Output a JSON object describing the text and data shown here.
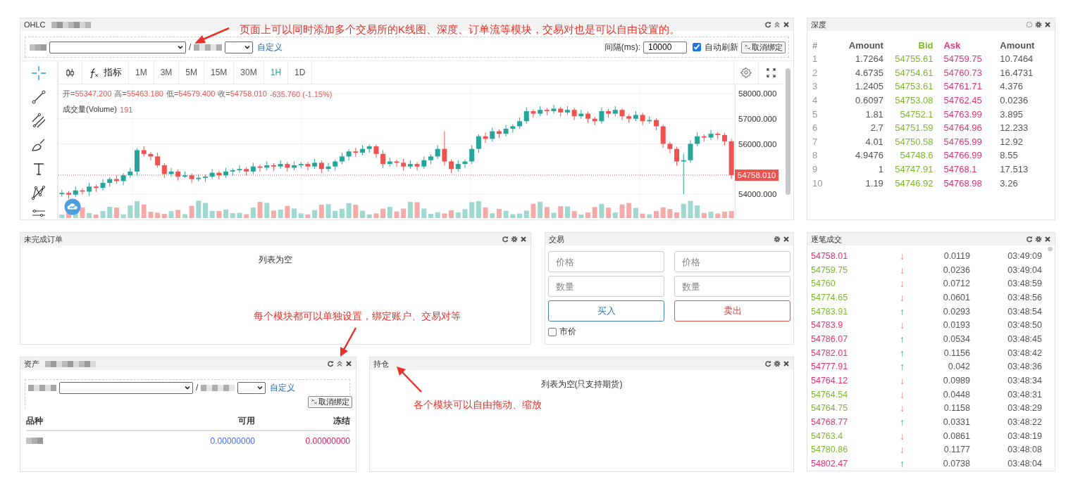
{
  "ohlc": {
    "title": "OHLC",
    "tools": [
      {
        "kind": "refresh"
      },
      {
        "kind": "collapse"
      },
      {
        "kind": "close"
      }
    ],
    "pair": {
      "separator": "/",
      "custom_link": "自定义",
      "interval_label": "间隔(ms):",
      "interval_value": "10000",
      "auto_refresh": {
        "label": "自动刷新",
        "checked": true
      },
      "unbind_button": "取消绑定"
    },
    "toolbar": {
      "indicator_button": "指标",
      "timeframes": [
        {
          "label": "1M",
          "selected": false
        },
        {
          "label": "3M",
          "selected": false
        },
        {
          "label": "5M",
          "selected": false
        },
        {
          "label": "15M",
          "selected": false
        },
        {
          "label": "30M",
          "selected": false
        },
        {
          "label": "1H",
          "selected": true
        },
        {
          "label": "1D",
          "selected": false
        }
      ]
    },
    "legend": {
      "items": [
        {
          "label": "开=",
          "value": "55347.200"
        },
        {
          "label": "高=",
          "value": "55463.180"
        },
        {
          "label": "低=",
          "value": "54579.400"
        },
        {
          "label": "收=",
          "value": "54758.010"
        }
      ],
      "change": "-635.760 (-1.15%)",
      "volume_label": "成交量(Volume)",
      "volume_value": "191"
    },
    "chart_data": {
      "type": "candlestick",
      "grid": true,
      "ylim": [
        53049,
        58364
      ],
      "categories": [
        null,
        null,
        null,
        null,
        null,
        null,
        null,
        null,
        null,
        null,
        null,
        null,
        null,
        null,
        null,
        null,
        null,
        null,
        null,
        null,
        null,
        null,
        null,
        null,
        null,
        null,
        null,
        null,
        null,
        null,
        null,
        null,
        null,
        null,
        null,
        null,
        null,
        null,
        null,
        null,
        null,
        null,
        null,
        null,
        null,
        null,
        null,
        null,
        null,
        null,
        null,
        null,
        null,
        null,
        null,
        null,
        null,
        null,
        null,
        null,
        null,
        null,
        null,
        null,
        null,
        null,
        null,
        null,
        null,
        null,
        null,
        null,
        null,
        null,
        null,
        null,
        null,
        null,
        null,
        null,
        null,
        null,
        null,
        null,
        null,
        null,
        null,
        null,
        null,
        null,
        null,
        null,
        null,
        null,
        null,
        null,
        null,
        null,
        null
      ],
      "yticks": [
        {
          "value": 58000,
          "label": "58000.000"
        },
        {
          "value": 57000,
          "label": "57000.000"
        },
        {
          "value": 56000,
          "label": "56000.000"
        },
        {
          "value": 54000,
          "label": "54000.000"
        }
      ],
      "ohlc": [
        [
          54000,
          54170,
          53900,
          54050
        ],
        [
          54050,
          54130,
          53820,
          53980
        ],
        [
          53980,
          54300,
          53880,
          54150
        ],
        [
          54150,
          54230,
          53990,
          54100
        ],
        [
          54100,
          54450,
          53940,
          54300
        ],
        [
          54300,
          54380,
          54090,
          54250
        ],
        [
          54250,
          54600,
          54150,
          54450
        ],
        [
          54450,
          54680,
          54290,
          54600
        ],
        [
          54600,
          54750,
          54420,
          54520
        ],
        [
          54520,
          54830,
          54360,
          54750
        ],
        [
          54750,
          55050,
          54650,
          54900
        ],
        [
          54900,
          55830,
          54740,
          55750
        ],
        [
          55750,
          55900,
          55500,
          55600
        ],
        [
          55600,
          55680,
          55340,
          55500
        ],
        [
          55500,
          55650,
          55050,
          55150
        ],
        [
          55150,
          55230,
          54640,
          54800
        ],
        [
          54800,
          55050,
          54700,
          54900
        ],
        [
          54900,
          54980,
          54540,
          54700
        ],
        [
          54700,
          54900,
          54650,
          54750
        ],
        [
          54750,
          54830,
          54440,
          54600
        ],
        [
          54600,
          54800,
          54500,
          54650
        ],
        [
          54650,
          54780,
          54490,
          54700
        ],
        [
          54700,
          55000,
          54600,
          54850
        ],
        [
          54850,
          54930,
          54590,
          54750
        ],
        [
          54750,
          55050,
          54650,
          54900
        ],
        [
          54900,
          55030,
          54740,
          54950
        ],
        [
          54950,
          55150,
          54850,
          55000
        ],
        [
          55000,
          55080,
          54740,
          54900
        ],
        [
          54900,
          55250,
          54800,
          55100
        ],
        [
          55100,
          55180,
          54890,
          55050
        ],
        [
          55050,
          55300,
          54950,
          55150
        ],
        [
          55150,
          55230,
          54940,
          55100
        ],
        [
          55100,
          55350,
          55000,
          55200
        ],
        [
          55200,
          55280,
          54890,
          55050
        ],
        [
          55050,
          55300,
          54950,
          55150
        ],
        [
          55150,
          55280,
          55040,
          55200
        ],
        [
          55200,
          55280,
          54940,
          55100
        ],
        [
          55100,
          55400,
          55000,
          55250
        ],
        [
          55250,
          55330,
          54840,
          55000
        ],
        [
          55000,
          55250,
          54900,
          55100
        ],
        [
          55100,
          55380,
          54940,
          55300
        ],
        [
          55300,
          55650,
          55200,
          55500
        ],
        [
          55500,
          55780,
          55340,
          55700
        ],
        [
          55700,
          55850,
          55490,
          55650
        ],
        [
          55650,
          55950,
          55550,
          55800
        ],
        [
          55800,
          55980,
          55640,
          55900
        ],
        [
          55900,
          55980,
          55440,
          55600
        ],
        [
          55600,
          55750,
          55040,
          55200
        ],
        [
          55200,
          55450,
          55100,
          55300
        ],
        [
          55300,
          55380,
          55090,
          55250
        ],
        [
          55250,
          55400,
          54940,
          55100
        ],
        [
          55100,
          55350,
          55000,
          55200
        ],
        [
          55200,
          55280,
          54940,
          55100
        ],
        [
          55100,
          55500,
          55000,
          55350
        ],
        [
          55350,
          55580,
          55190,
          55500
        ],
        [
          55500,
          55950,
          55400,
          55800
        ],
        [
          55800,
          56500,
          55140,
          55300
        ],
        [
          55300,
          55380,
          54840,
          55000
        ],
        [
          55000,
          55350,
          54900,
          55200
        ],
        [
          55200,
          55380,
          55040,
          55300
        ],
        [
          55300,
          55950,
          55200,
          55800
        ],
        [
          55800,
          56380,
          55640,
          56300
        ],
        [
          56300,
          56450,
          56040,
          56200
        ],
        [
          56200,
          56650,
          56100,
          56500
        ],
        [
          56500,
          56580,
          56240,
          56400
        ],
        [
          56400,
          56750,
          56300,
          56600
        ],
        [
          56600,
          56780,
          56440,
          56700
        ],
        [
          56700,
          57050,
          56600,
          56900
        ],
        [
          56900,
          57450,
          56800,
          57300
        ],
        [
          57300,
          57380,
          57040,
          57200
        ],
        [
          57200,
          57500,
          57100,
          57350
        ],
        [
          57350,
          57430,
          57140,
          57300
        ],
        [
          57300,
          57550,
          57200,
          57400
        ],
        [
          57400,
          57480,
          57090,
          57250
        ],
        [
          57250,
          57500,
          57150,
          57350
        ],
        [
          57350,
          57430,
          56940,
          57100
        ],
        [
          57100,
          57350,
          57000,
          57200
        ],
        [
          57200,
          57280,
          56840,
          57000
        ],
        [
          57000,
          57080,
          56740,
          56900
        ],
        [
          56900,
          57450,
          56800,
          57300
        ],
        [
          57300,
          57380,
          57040,
          57200
        ],
        [
          57200,
          57500,
          57100,
          57350
        ],
        [
          57350,
          57430,
          56940,
          57100
        ],
        [
          57100,
          57180,
          56840,
          57000
        ],
        [
          57000,
          57300,
          56900,
          57150
        ],
        [
          57150,
          57230,
          56740,
          56900
        ],
        [
          56900,
          57100,
          56800,
          56950
        ],
        [
          56950,
          57030,
          56540,
          56700
        ],
        [
          56700,
          56780,
          55840,
          56000
        ],
        [
          56000,
          56080,
          55640,
          55800
        ],
        [
          55800,
          55880,
          55140,
          55300
        ],
        [
          55300,
          55600,
          54000,
          55350
        ],
        [
          55350,
          56150,
          55250,
          56000
        ],
        [
          56000,
          56450,
          55900,
          56300
        ],
        [
          56300,
          56380,
          56090,
          56250
        ],
        [
          56250,
          56550,
          56150,
          56400
        ],
        [
          56400,
          56480,
          56190,
          56350
        ],
        [
          56350,
          56430,
          55940,
          56100
        ],
        [
          56100,
          56200,
          54600,
          54758
        ]
      ]
    },
    "last_price": "54758.010"
  },
  "depth": {
    "title": "深度",
    "tools": [
      {
        "kind": "spinner"
      },
      {
        "kind": "settings"
      },
      {
        "kind": "close"
      }
    ],
    "columns": [
      "#",
      "Amount",
      "Bid",
      "Ask",
      "Amount"
    ],
    "rows": [
      [
        "1",
        "1.7264",
        "54755.61",
        "54759.75",
        "10.7464"
      ],
      [
        "2",
        "4.6735",
        "54754.61",
        "54760.73",
        "16.4731"
      ],
      [
        "3",
        "1.2405",
        "54753.61",
        "54761.71",
        "4.376"
      ],
      [
        "4",
        "0.6097",
        "54753.08",
        "54762.45",
        "0.0236"
      ],
      [
        "5",
        "1.81",
        "54752.1",
        "54763.99",
        "3.895"
      ],
      [
        "6",
        "2.7",
        "54751.59",
        "54764.96",
        "12.233"
      ],
      [
        "7",
        "4.01",
        "54750.58",
        "54765.99",
        "12.92"
      ],
      [
        "8",
        "4.9476",
        "54748.6",
        "54766.99",
        "8.55"
      ],
      [
        "9",
        "1",
        "54747.91",
        "54768.1",
        "17.513"
      ],
      [
        "10",
        "1.19",
        "54746.92",
        "54768.98",
        "3.26"
      ]
    ]
  },
  "orders": {
    "title": "未完成订单",
    "tools": [
      {
        "kind": "refresh"
      },
      {
        "kind": "settings"
      },
      {
        "kind": "close"
      }
    ],
    "empty_text": "列表为空"
  },
  "trade": {
    "title": "交易",
    "tools": [
      {
        "kind": "settings"
      },
      {
        "kind": "close"
      }
    ],
    "sides": [
      {
        "kind": "buy",
        "price_placeholder": "价格",
        "amount_placeholder": "数量",
        "button": "买入"
      },
      {
        "kind": "sell",
        "price_placeholder": "价格",
        "amount_placeholder": "数量",
        "button": "卖出"
      }
    ],
    "market_order": {
      "label": "市价",
      "checked": false
    }
  },
  "trades": {
    "title": "逐笔成交",
    "tools": [
      {
        "kind": "refresh"
      },
      {
        "kind": "settings"
      },
      {
        "kind": "close"
      }
    ],
    "rows": [
      {
        "price": "54758.01",
        "color": "#e8336d",
        "kind": "down",
        "arrow": "↓",
        "amount": "0.0119",
        "time": "03:49:09"
      },
      {
        "price": "54759.75",
        "color": "#7cb82f",
        "kind": "down",
        "arrow": "↓",
        "amount": "0.0236",
        "time": "03:49:04"
      },
      {
        "price": "54760",
        "color": "#7cb82f",
        "kind": "down",
        "arrow": "↓",
        "amount": "0.0712",
        "time": "03:48:59"
      },
      {
        "price": "54774.65",
        "color": "#7cb82f",
        "kind": "down",
        "arrow": "↓",
        "amount": "0.0601",
        "time": "03:48:56"
      },
      {
        "price": "54783.91",
        "color": "#7cb82f",
        "kind": "up",
        "arrow": "↑",
        "amount": "0.0293",
        "time": "03:48:54"
      },
      {
        "price": "54783.9",
        "color": "#e8336d",
        "kind": "down",
        "arrow": "↓",
        "amount": "0.0193",
        "time": "03:48:50"
      },
      {
        "price": "54786.07",
        "color": "#e8336d",
        "kind": "up",
        "arrow": "↑",
        "amount": "0.0534",
        "time": "03:48:45"
      },
      {
        "price": "54782.01",
        "color": "#e8336d",
        "kind": "up",
        "arrow": "↑",
        "amount": "0.1156",
        "time": "03:48:42"
      },
      {
        "price": "54777.91",
        "color": "#e8336d",
        "kind": "up",
        "arrow": "↑",
        "amount": "0.042",
        "time": "03:48:36"
      },
      {
        "price": "54764.12",
        "color": "#e8336d",
        "kind": "down",
        "arrow": "↓",
        "amount": "0.0989",
        "time": "03:48:34"
      },
      {
        "price": "54764.54",
        "color": "#7cb82f",
        "kind": "down",
        "arrow": "↓",
        "amount": "0.0448",
        "time": "03:48:31"
      },
      {
        "price": "54764.75",
        "color": "#7cb82f",
        "kind": "down",
        "arrow": "↓",
        "amount": "0.1158",
        "time": "03:48:29"
      },
      {
        "price": "54768.77",
        "color": "#e8336d",
        "kind": "up",
        "arrow": "↑",
        "amount": "0.0331",
        "time": "03:48:22"
      },
      {
        "price": "54763.4",
        "color": "#7cb82f",
        "kind": "down",
        "arrow": "↓",
        "amount": "0.0861",
        "time": "03:48:19"
      },
      {
        "price": "54780.86",
        "color": "#7cb82f",
        "kind": "down",
        "arrow": "↓",
        "amount": "0.1177",
        "time": "03:48:08"
      },
      {
        "price": "54802.47",
        "color": "#e8336d",
        "kind": "up",
        "arrow": "↑",
        "amount": "0.0738",
        "time": "03:48:04"
      }
    ]
  },
  "assets": {
    "title": "资产",
    "tools": [
      {
        "kind": "refresh"
      },
      {
        "kind": "collapse"
      },
      {
        "kind": "close"
      }
    ],
    "separator": "/",
    "custom_link": "自定义",
    "unbind_button": "取消绑定",
    "columns": [
      "品种",
      "可用",
      "冻结"
    ],
    "rows": [
      {
        "available": "0.00000000",
        "frozen": "0.00000000"
      }
    ]
  },
  "positions": {
    "title": "持仓",
    "tools": [
      {
        "kind": "refresh"
      },
      {
        "kind": "settings"
      },
      {
        "kind": "close"
      }
    ],
    "empty_text": "列表为空(只支持期货)"
  },
  "annotations": [
    {
      "text": "页面上可以同时添加多个交易所的K线图、深度、订单流等模块，交易对也是可以自由设置的。"
    },
    {
      "text": "每个模块都可以单独设置，绑定账户、交易对等"
    },
    {
      "text": "各个模块可以自由拖动、缩放"
    }
  ]
}
